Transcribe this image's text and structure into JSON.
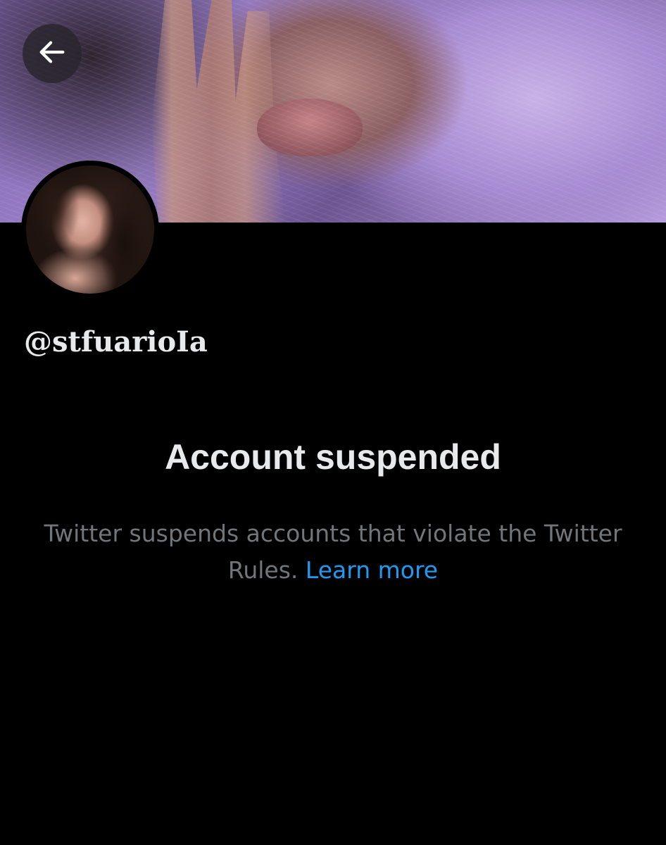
{
  "header": {
    "back_icon": "arrow-left-icon",
    "banner_description": ""
  },
  "profile": {
    "handle": "@stfuarioIa"
  },
  "suspension": {
    "title": "Account suspended",
    "message": "Twitter suspends accounts that violate the Twitter Rules.",
    "link_label": "Learn more"
  },
  "colors": {
    "background": "#000000",
    "primary_text": "#e7e9ea",
    "secondary_text": "#71767b",
    "link": "#1d9bf0"
  }
}
